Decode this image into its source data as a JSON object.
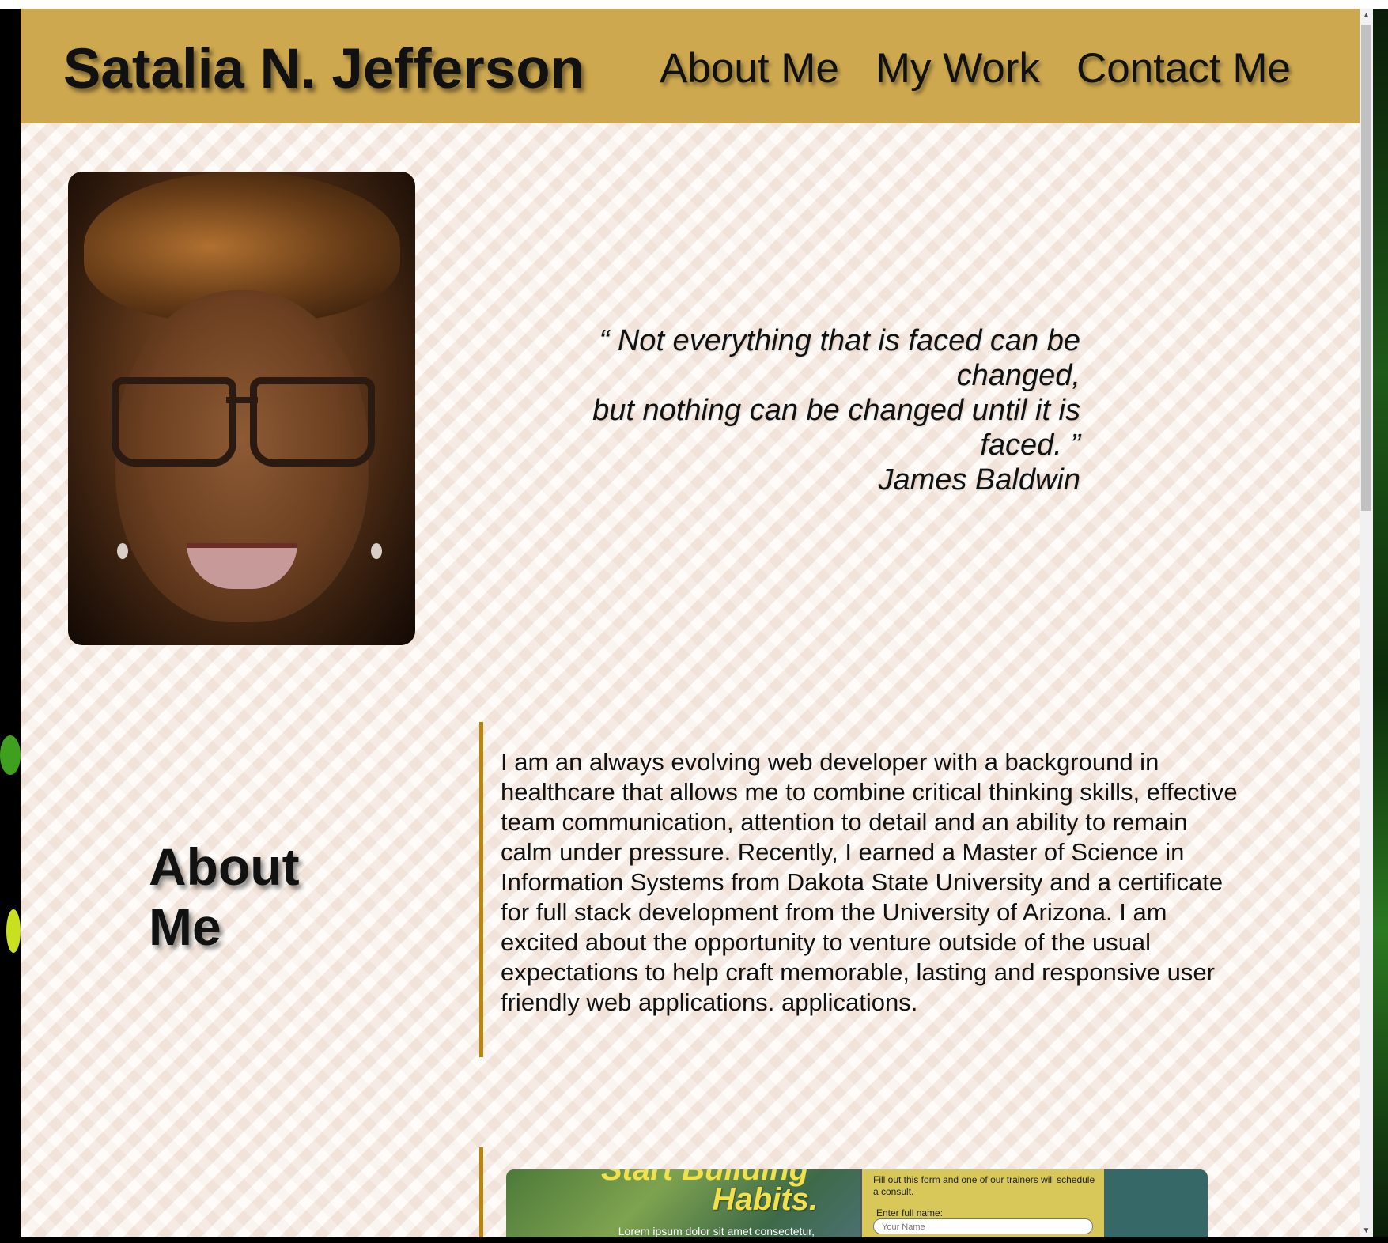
{
  "site": {
    "title": "Satalia N. Jefferson",
    "nav": [
      "About Me",
      "My Work",
      "Contact Me"
    ]
  },
  "hero": {
    "quote_line1": "“ Not everything that is faced can be changed,",
    "quote_line2": "but nothing can be changed until it is faced. ”",
    "quote_author": "James Baldwin"
  },
  "about": {
    "heading": "About Me",
    "body": "I am an always evolving web developer with a background in healthcare that allows me to combine critical thinking skills, effective team communication, attention to detail and an ability to remain calm under pressure. Recently, I earned a Master of Science in Information Systems from Dakota State University and a certificate for full stack development from the University of Arizona. I am excited about the opportunity to venture outside of the usual expectations to help craft memorable, lasting and responsive user friendly web applications. applications."
  },
  "work_preview": {
    "heading_top": "Start Building",
    "heading": "Habits.",
    "lorem": "Lorem ipsum dolor sit amet consectetur,",
    "form_note": "Fill out this form and one of our trainers will schedule a consult.",
    "form_label": "Enter full name:",
    "form_placeholder": "Your Name"
  },
  "colors": {
    "header_bg": "#cda84f",
    "accent_border": "#b8860b",
    "page_bg": "#fbf1ea"
  }
}
